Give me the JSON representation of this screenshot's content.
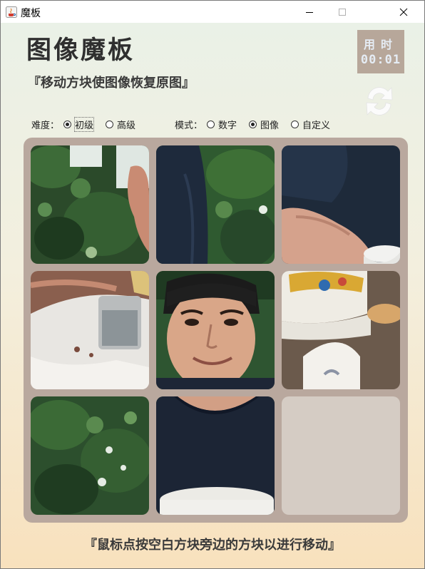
{
  "window": {
    "title": "魔板",
    "controls": [
      "minimize",
      "maximize",
      "close"
    ]
  },
  "header": {
    "title": "图像魔板",
    "subtitle": "『移动方块使图像恢复原图』"
  },
  "timer": {
    "label": "用时",
    "value": "00:01"
  },
  "refresh": {
    "icon": "refresh-icon"
  },
  "difficulty": {
    "label": "难度：",
    "options": [
      {
        "label": "初级",
        "selected": true
      },
      {
        "label": "高级",
        "selected": false
      }
    ]
  },
  "mode": {
    "label": "模式：",
    "options": [
      {
        "label": "数字",
        "selected": false
      },
      {
        "label": "图像",
        "selected": true
      },
      {
        "label": "自定义",
        "selected": false
      }
    ]
  },
  "board": {
    "size": 3,
    "tiles": [
      {
        "content": "foliage-with-hand",
        "empty": false
      },
      {
        "content": "shirt-and-leaves",
        "empty": false
      },
      {
        "content": "hand-holding-bowl",
        "empty": false
      },
      {
        "content": "glass-on-table",
        "empty": false
      },
      {
        "content": "smiling-face",
        "empty": false
      },
      {
        "content": "bowls-on-table",
        "empty": false
      },
      {
        "content": "foliage",
        "empty": false
      },
      {
        "content": "shirt-and-bowl",
        "empty": false
      },
      {
        "content": "",
        "empty": true
      }
    ]
  },
  "footer": {
    "hint": "『鼠标点按空白方块旁边的方块以进行移动』"
  },
  "colors": {
    "board_bg": "#b9a89e",
    "empty_tile": "#d5ccc4",
    "timer_bg": "#b7a79a",
    "timer_text": "#e5ecf4"
  }
}
